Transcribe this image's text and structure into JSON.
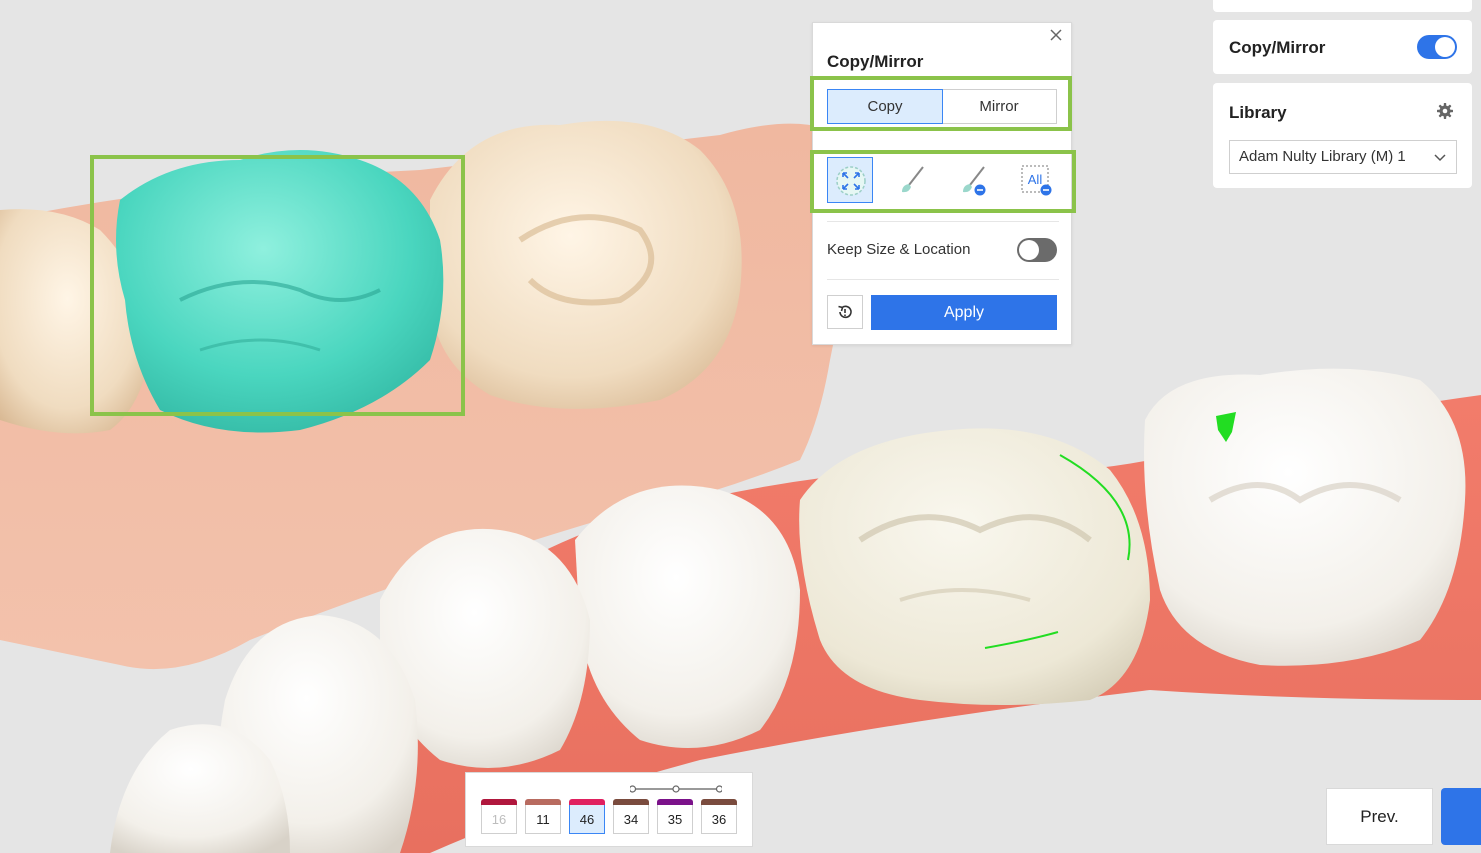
{
  "panel": {
    "title": "Copy/Mirror",
    "copy_label": "Copy",
    "mirror_label": "Mirror",
    "active_mode": "Copy",
    "tool_icons": [
      "auto-fit-icon",
      "brush-icon",
      "brush-erase-icon",
      "erase-all-icon"
    ],
    "all_icon_text": "All",
    "keep_label": "Keep Size & Location",
    "keep_enabled": false,
    "apply_label": "Apply"
  },
  "sidebar": {
    "copy_mirror_label": "Copy/Mirror",
    "copy_mirror_enabled": true,
    "library_label": "Library",
    "library_value": "Adam Nulty Library (M) 1"
  },
  "teeth": [
    {
      "label": "16",
      "color": "#b0173d",
      "state": "disabled"
    },
    {
      "label": "11",
      "color": "#b86b60",
      "state": "normal"
    },
    {
      "label": "46",
      "color": "#e0205f",
      "state": "selected"
    },
    {
      "label": "34",
      "color": "#7a4b3e",
      "state": "normal"
    },
    {
      "label": "35",
      "color": "#7b128a",
      "state": "normal"
    },
    {
      "label": "36",
      "color": "#7a4b3e",
      "state": "normal"
    }
  ],
  "nav": {
    "prev_label": "Prev."
  },
  "colors": {
    "accent": "#2e74e8",
    "highlight_frame": "#8bc34a",
    "selected_crown": "#4ad6bf",
    "gingiva_upper": "#eeb29a",
    "gingiva_lower": "#f07a6a",
    "tooth": "#f1ece4"
  }
}
